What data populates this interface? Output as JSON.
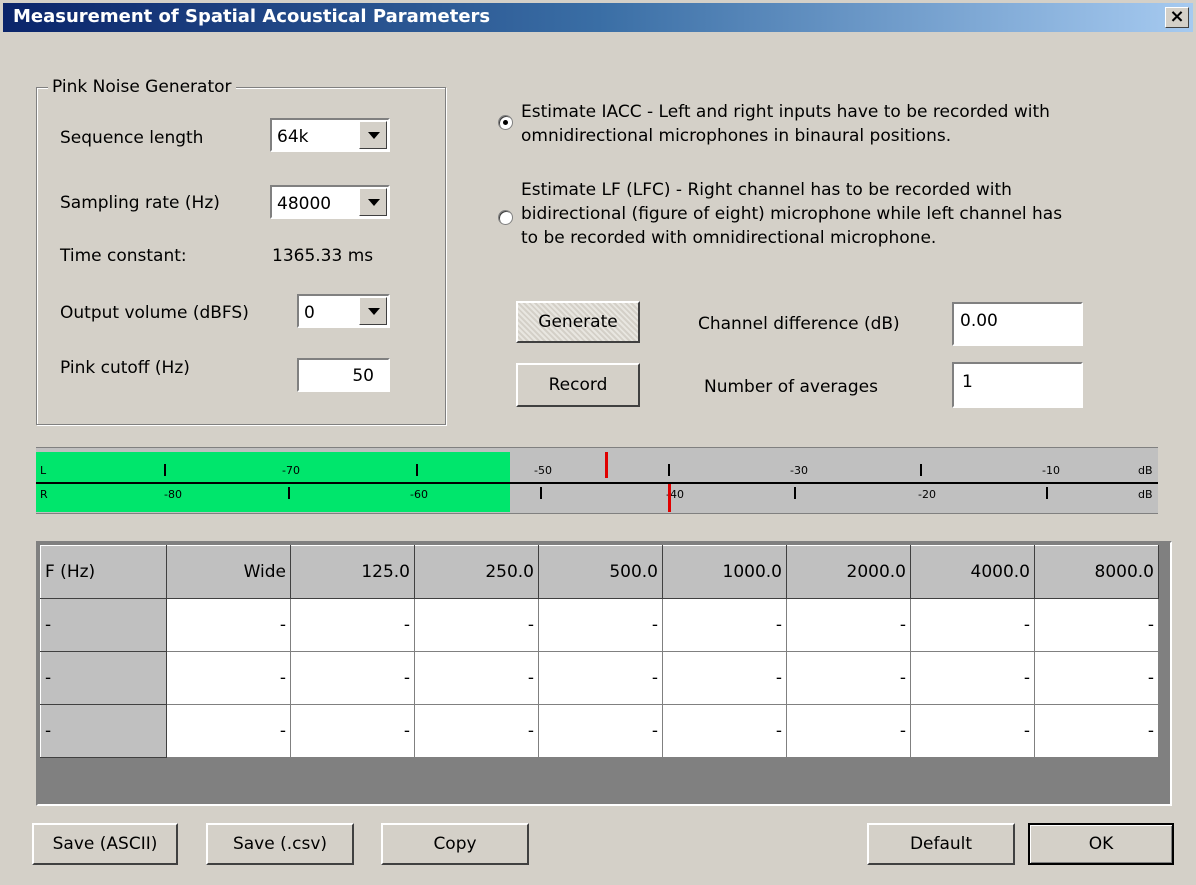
{
  "window": {
    "title": "Measurement of Spatial Acoustical Parameters",
    "close_label": "×"
  },
  "generator": {
    "group_title": "Pink Noise Generator",
    "sequence_length_label": "Sequence length",
    "sequence_length_value": "64k",
    "sampling_rate_label": "Sampling rate (Hz)",
    "sampling_rate_value": "48000",
    "time_constant_label": "Time constant:",
    "time_constant_value": "1365.33 ms",
    "output_volume_label": "Output volume (dBFS)",
    "output_volume_value": "0",
    "pink_cutoff_label": "Pink cutoff (Hz)",
    "pink_cutoff_value": "50"
  },
  "modes": {
    "iacc_line1": "Estimate IACC - Left and right inputs have to be recorded with",
    "iacc_line2": "omnidirectional microphones in binaural positions.",
    "lf_line1": "Estimate LF (LFC) - Right channel has to be recorded with",
    "lf_line2": "bidirectional (figure of eight) microphone while left channel has",
    "lf_line3": "to be recorded with omnidirectional microphone.",
    "selected": "iacc"
  },
  "controls": {
    "generate_label": "Generate",
    "record_label": "Record",
    "channel_diff_label": "Channel difference (dB)",
    "channel_diff_value": "0.00",
    "averages_label": "Number of averages",
    "averages_value": "1"
  },
  "meter": {
    "left_channel": "L",
    "right_channel": "R",
    "left_scale": [
      "-70",
      "-50",
      "-30",
      "-10"
    ],
    "right_scale": [
      "-80",
      "-60",
      "-40",
      "-20"
    ],
    "unit": "dB",
    "fill_color": "#00e66c",
    "peak_color": "#e00000"
  },
  "table": {
    "headers": [
      "F (Hz)",
      "Wide",
      "125.0",
      "250.0",
      "500.0",
      "1000.0",
      "2000.0",
      "4000.0",
      "8000.0"
    ],
    "rows": [
      [
        "-",
        "-",
        "-",
        "-",
        "-",
        "-",
        "-",
        "-",
        "-"
      ],
      [
        "-",
        "-",
        "-",
        "-",
        "-",
        "-",
        "-",
        "-",
        "-"
      ],
      [
        "-",
        "-",
        "-",
        "-",
        "-",
        "-",
        "-",
        "-",
        "-"
      ]
    ]
  },
  "buttons": {
    "save_ascii": "Save (ASCII)",
    "save_csv": "Save (.csv)",
    "copy": "Copy",
    "default": "Default",
    "ok": "OK"
  }
}
